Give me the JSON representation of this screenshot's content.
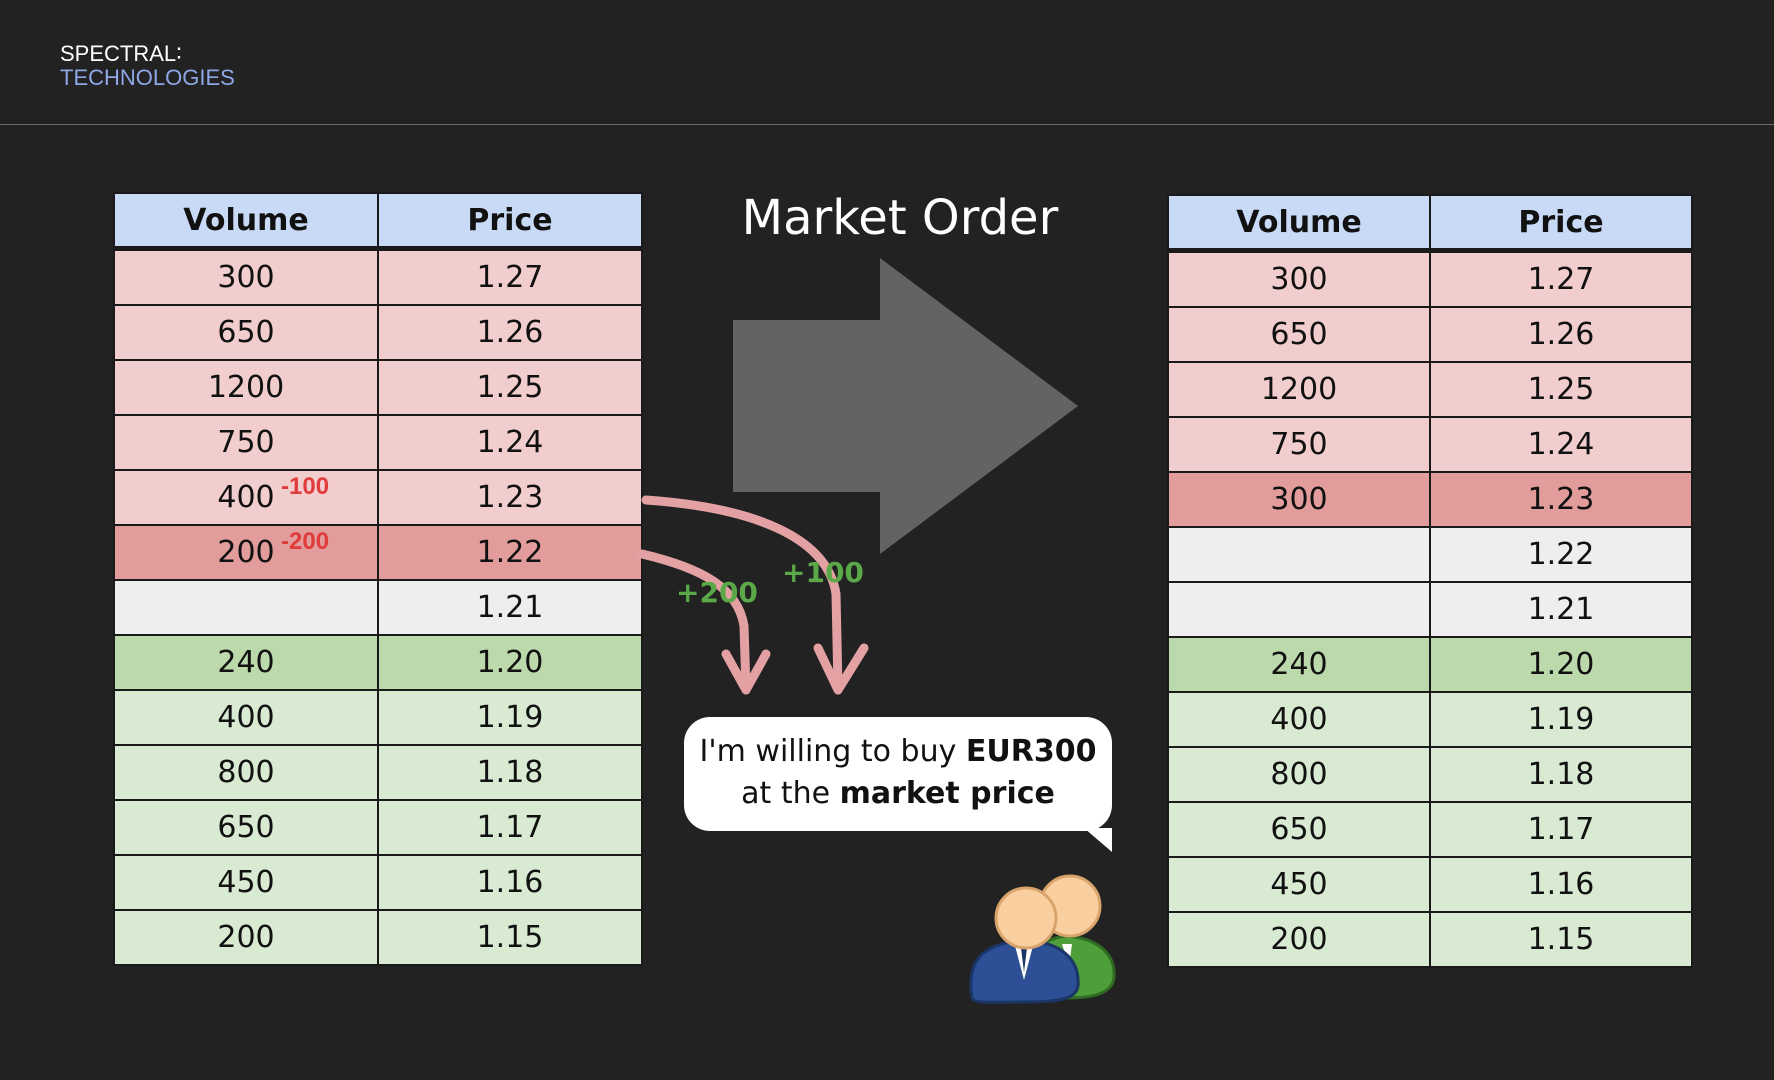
{
  "logo": {
    "line1": "SPECTRAL∶",
    "line2": "TECHNOLOGIES"
  },
  "title": "Market Order",
  "table_headers": {
    "volume": "Volume",
    "price": "Price"
  },
  "before_book": [
    {
      "volume": "300",
      "price": "1.27",
      "side": "ask",
      "delta": ""
    },
    {
      "volume": "650",
      "price": "1.26",
      "side": "ask",
      "delta": ""
    },
    {
      "volume": "1200",
      "price": "1.25",
      "side": "ask",
      "delta": ""
    },
    {
      "volume": "750",
      "price": "1.24",
      "side": "ask",
      "delta": ""
    },
    {
      "volume": "400",
      "price": "1.23",
      "side": "ask",
      "delta": "-100"
    },
    {
      "volume": "200",
      "price": "1.22",
      "side": "ask-hl",
      "delta": "-200"
    },
    {
      "volume": "",
      "price": "1.21",
      "side": "empty",
      "delta": ""
    },
    {
      "volume": "240",
      "price": "1.20",
      "side": "bid-hl",
      "delta": ""
    },
    {
      "volume": "400",
      "price": "1.19",
      "side": "bid",
      "delta": ""
    },
    {
      "volume": "800",
      "price": "1.18",
      "side": "bid",
      "delta": ""
    },
    {
      "volume": "650",
      "price": "1.17",
      "side": "bid",
      "delta": ""
    },
    {
      "volume": "450",
      "price": "1.16",
      "side": "bid",
      "delta": ""
    },
    {
      "volume": "200",
      "price": "1.15",
      "side": "bid",
      "delta": ""
    }
  ],
  "after_book": [
    {
      "volume": "300",
      "price": "1.27",
      "side": "ask"
    },
    {
      "volume": "650",
      "price": "1.26",
      "side": "ask"
    },
    {
      "volume": "1200",
      "price": "1.25",
      "side": "ask"
    },
    {
      "volume": "750",
      "price": "1.24",
      "side": "ask"
    },
    {
      "volume": "300",
      "price": "1.23",
      "side": "ask-hl"
    },
    {
      "volume": "",
      "price": "1.22",
      "side": "empty"
    },
    {
      "volume": "",
      "price": "1.21",
      "side": "empty"
    },
    {
      "volume": "240",
      "price": "1.20",
      "side": "bid-hl"
    },
    {
      "volume": "400",
      "price": "1.19",
      "side": "bid"
    },
    {
      "volume": "800",
      "price": "1.18",
      "side": "bid"
    },
    {
      "volume": "650",
      "price": "1.17",
      "side": "bid"
    },
    {
      "volume": "450",
      "price": "1.16",
      "side": "bid"
    },
    {
      "volume": "200",
      "price": "1.15",
      "side": "bid"
    }
  ],
  "flow_labels": {
    "from_122": "+200",
    "from_123": "+100"
  },
  "bubble": {
    "line1_plain": "I'm willing to buy ",
    "line1_bold": "EUR300",
    "line2_plain": "at the ",
    "line2_bold": "market price"
  },
  "colors": {
    "header": "#c9daf7",
    "ask": "#f2cdcd",
    "ask_highlight": "#e29c9c",
    "empty": "#eeeeee",
    "bid_highlight": "#bcd9ac",
    "bid": "#d9ead3",
    "delta": "#e03c3c",
    "flow_label": "#5aa848",
    "flow_arrow": "#e3a1a4",
    "big_arrow": "#636363"
  },
  "icons": {
    "flow": "curved-arrow",
    "main": "right-arrow",
    "trader": "people-icon"
  }
}
